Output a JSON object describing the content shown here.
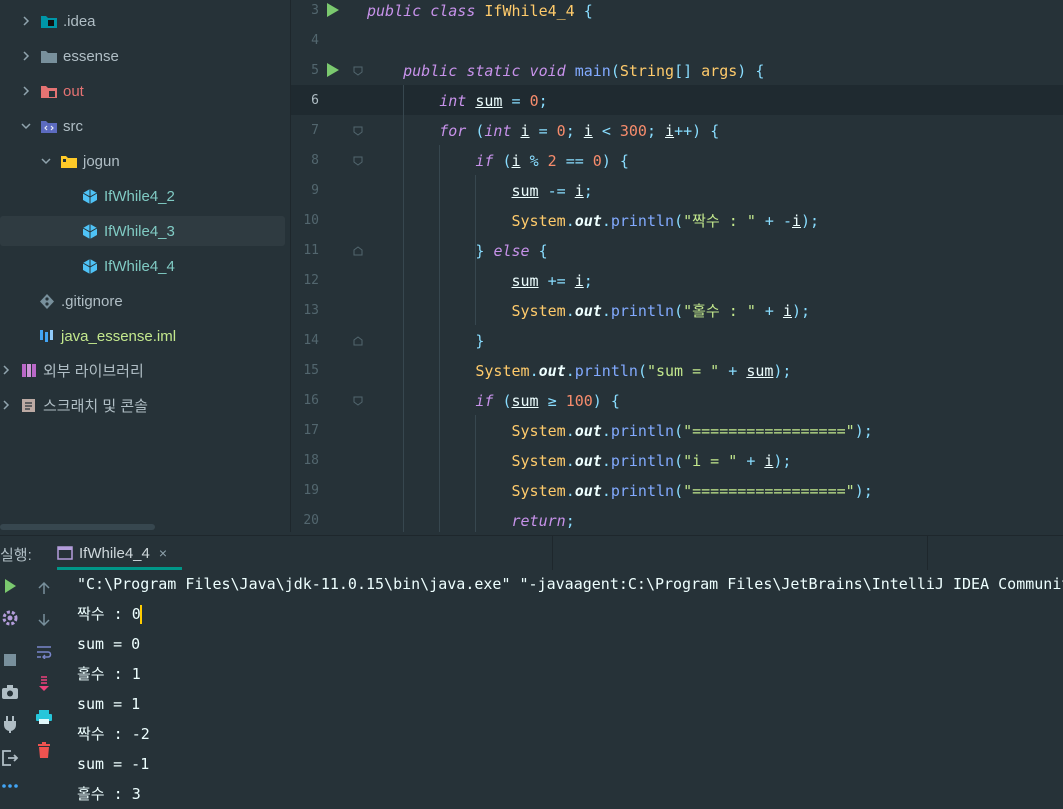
{
  "project_tree": {
    "items": [
      {
        "label": ".idea"
      },
      {
        "label": "essense"
      },
      {
        "label": "out"
      },
      {
        "label": "src"
      },
      {
        "label": "jogun"
      },
      {
        "label": "IfWhile4_2"
      },
      {
        "label": "IfWhile4_3"
      },
      {
        "label": "IfWhile4_4"
      },
      {
        "label": ".gitignore"
      },
      {
        "label": "java_essense.iml"
      },
      {
        "label": "외부 라이브러리"
      },
      {
        "label": "스크래치 및 콘솔"
      }
    ]
  },
  "editor": {
    "current_line": "6",
    "line_numbers": [
      "3",
      "4",
      "5",
      "6",
      "7",
      "8",
      "9",
      "10",
      "11",
      "12",
      "13",
      "14",
      "15",
      "16",
      "17",
      "18",
      "19",
      "20"
    ]
  },
  "run_panel": {
    "label": "실행:",
    "tab_label": "IfWhile4_4",
    "close_glyph": "×",
    "console_lines": [
      "\"C:\\Program Files\\Java\\jdk-11.0.15\\bin\\java.exe\" \"-javaagent:C:\\Program Files\\JetBrains\\IntelliJ IDEA Communit",
      "짝수 : 0",
      "sum = 0",
      "홀수 : 1",
      "sum = 1",
      "짝수 : -2",
      "sum = -1",
      "홀수 : 3"
    ]
  },
  "icons": {
    "run": "run-icon",
    "settings": "settings-icon",
    "stop": "stop-icon",
    "camera": "camera-icon",
    "plug": "plug-icon",
    "exit": "exit-icon",
    "more": "more-icon",
    "up": "arrow-up-icon",
    "down": "arrow-down-icon",
    "wrap": "soft-wrap-icon",
    "scroll_end": "scroll-to-end-icon",
    "print": "print-icon",
    "trash": "trash-icon"
  },
  "colors": {
    "background": "#263238",
    "current_line": "#1f2a30",
    "keyword": "#c792ea",
    "class": "#ffcb6b",
    "function": "#82aaff",
    "number": "#f78c6c",
    "string": "#c3e88d",
    "operator": "#89ddff",
    "run_green": "#7bc96f",
    "tab_underline": "#009688"
  }
}
